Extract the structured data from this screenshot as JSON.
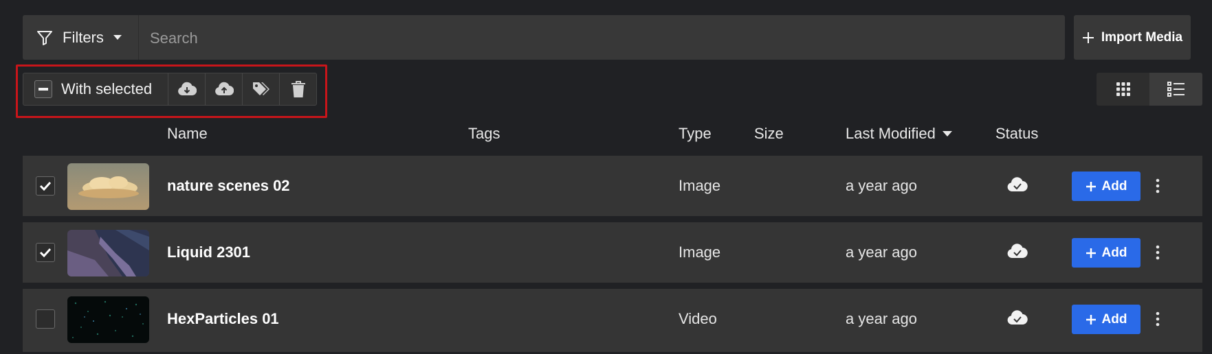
{
  "toolbar": {
    "filters_label": "Filters",
    "search_placeholder": "Search",
    "import_label": "Import Media",
    "bulk_label": "With selected"
  },
  "icons": {
    "filter": "filter-icon",
    "dropdown": "chevron-down-icon",
    "plus": "plus-icon",
    "download": "cloud-download-icon",
    "upload": "cloud-upload-icon",
    "tags": "tags-icon",
    "trash": "trash-icon",
    "grid": "grid-view-icon",
    "list": "list-view-icon",
    "status": "cloud-check-icon",
    "more": "more-vertical-icon"
  },
  "columns": {
    "name": "Name",
    "tags": "Tags",
    "type": "Type",
    "size": "Size",
    "last_modified": "Last Modified",
    "status": "Status"
  },
  "rows": [
    {
      "name": "nature scenes 02",
      "tags": "",
      "type": "Image",
      "size": "",
      "modified": "a year ago",
      "checked": true,
      "add_label": "Add"
    },
    {
      "name": "Liquid 2301",
      "tags": "",
      "type": "Image",
      "size": "",
      "modified": "a year ago",
      "checked": true,
      "add_label": "Add"
    },
    {
      "name": "HexParticles 01",
      "tags": "",
      "type": "Video",
      "size": "",
      "modified": "a year ago",
      "checked": false,
      "add_label": "Add"
    }
  ],
  "colors": {
    "background": "#202124",
    "accent": "#2a6ae8",
    "highlight_box": "#c8151a"
  }
}
